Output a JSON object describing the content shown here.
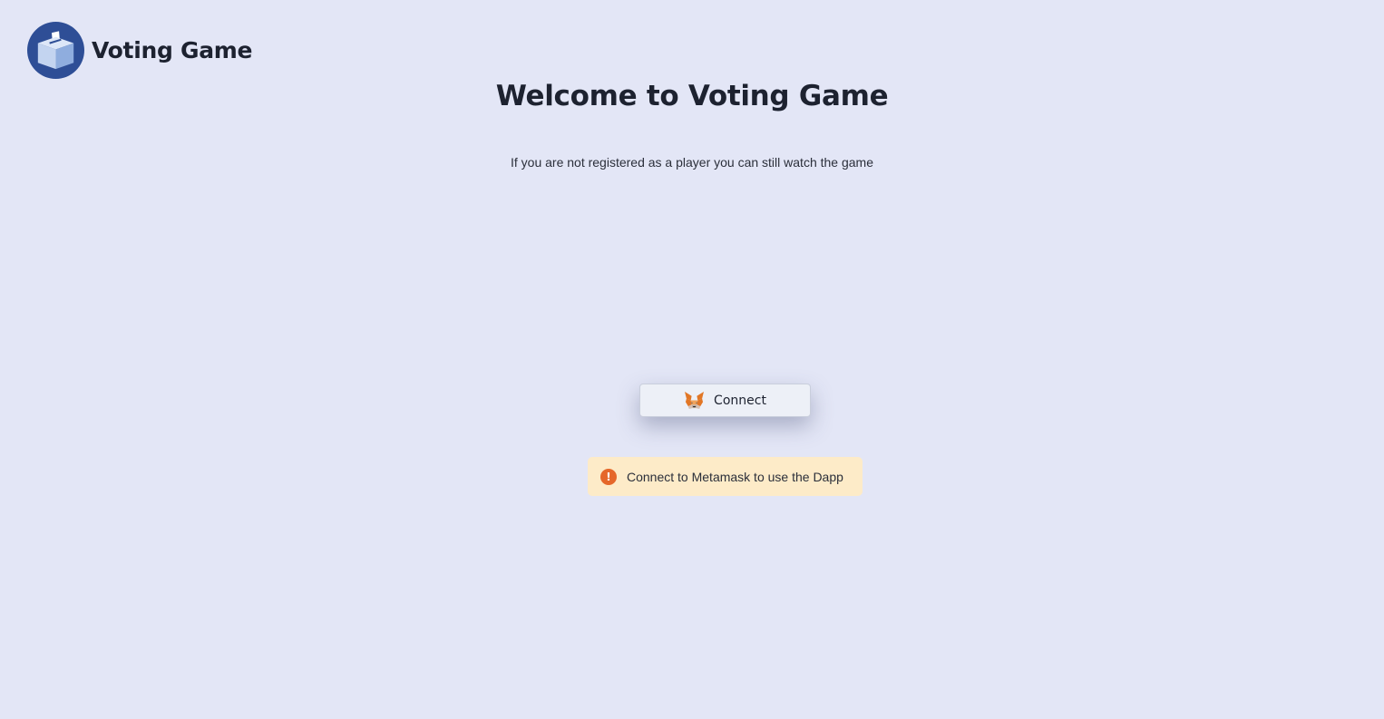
{
  "header": {
    "app_name": "Voting Game",
    "logo_icon": "ballot-box-icon"
  },
  "main": {
    "title": "Welcome to Voting Game",
    "subtitle": "If you are not registered as a player you can still watch the game",
    "connect_button": {
      "label": "Connect",
      "icon": "metamask-fox-icon"
    },
    "alert": {
      "icon": "warning-icon",
      "icon_glyph": "!",
      "message": "Connect to Metamask to use the Dapp"
    }
  },
  "colors": {
    "background": "#e3e6f6",
    "logo_circle": "#2e4e96",
    "alert_background": "#fdebc8",
    "alert_icon": "#e5672a"
  }
}
